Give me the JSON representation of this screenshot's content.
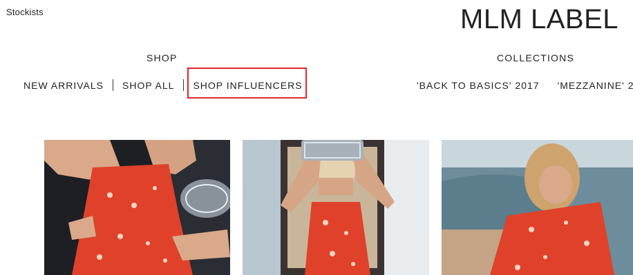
{
  "header": {
    "stockists_label": "Stockists",
    "brand": "MLM LABEL"
  },
  "nav": {
    "shop": {
      "title": "SHOP",
      "links": [
        "NEW ARRIVALS",
        "SHOP ALL",
        "SHOP INFLUENCERS"
      ]
    },
    "collections": {
      "title": "COLLECTIONS",
      "links": [
        "'BACK TO BASICS' 2017",
        "'MEZZANINE' 2"
      ]
    }
  },
  "colors": {
    "highlight": "#e0252b",
    "dress": "#e0412a",
    "text": "#222222"
  },
  "products": [
    {
      "image": "model-red-floral-dress-with-clear-bag"
    },
    {
      "image": "model-red-floral-dress-holding-bag-overhead"
    },
    {
      "image": "model-red-floral-ruffle-dress-outdoors"
    }
  ]
}
